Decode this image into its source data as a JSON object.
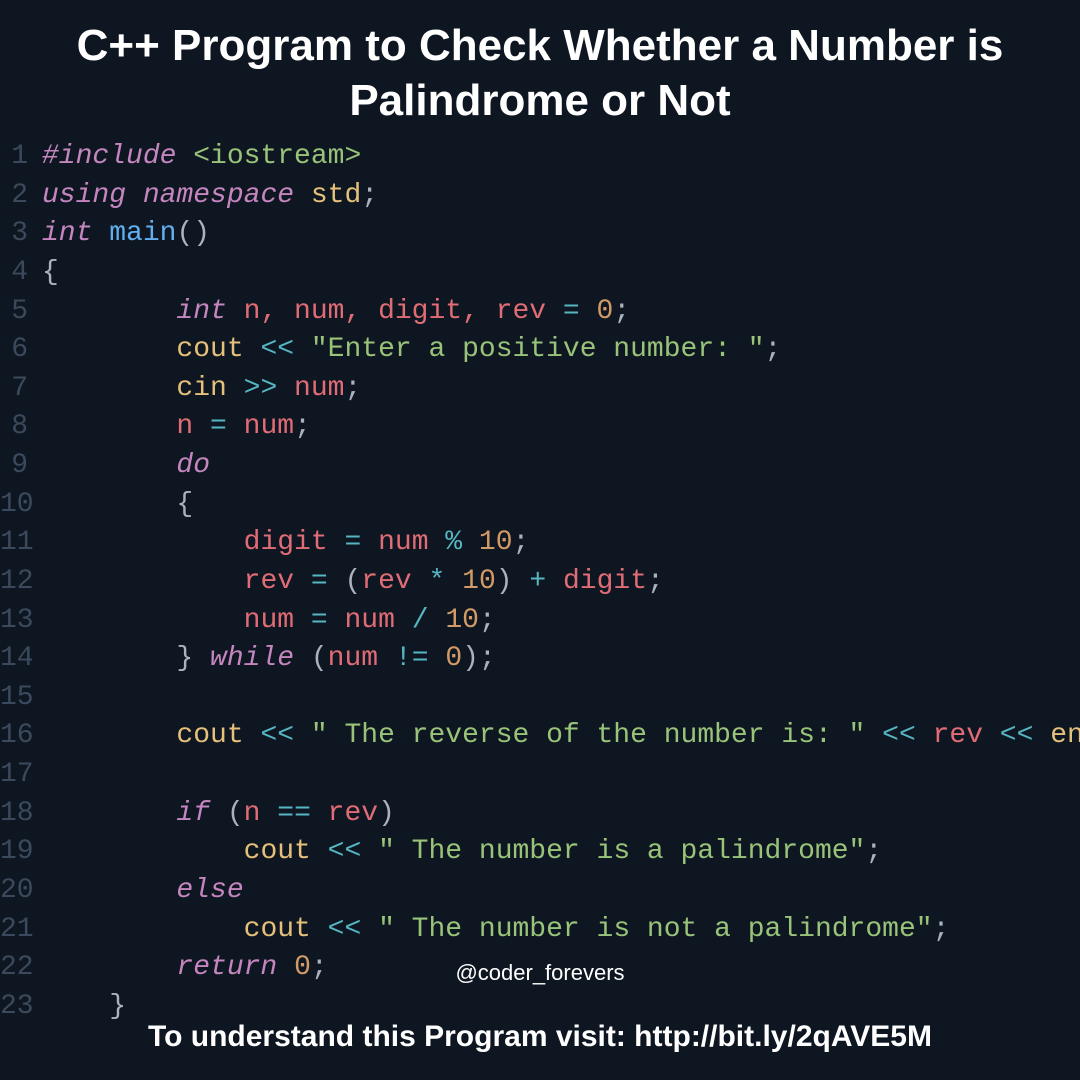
{
  "title": "C++ Program to Check Whether a Number is Palindrome or Not",
  "handle": "@coder_forevers",
  "footer": "To understand this Program visit: http://bit.ly/2qAVE5M",
  "code": {
    "ln1_include": "#include",
    "ln1_header": " <iostream>",
    "ln2_using": "using",
    "ln2_namespace": " namespace",
    "ln2_std": " std",
    "ln2_semi": ";",
    "ln3_int": "int",
    "ln3_main": " main",
    "ln3_paren": "()",
    "ln4_brace": "{",
    "ln5_indent": "        ",
    "ln5_int": "int",
    "ln5_vars": " n, num, digit, rev ",
    "ln5_eq": "=",
    "ln5_sp": " ",
    "ln5_zero": "0",
    "ln5_semi": ";",
    "ln6_indent": "        ",
    "ln6_cout": "cout ",
    "ln6_op": "<<",
    "ln6_sp": " ",
    "ln6_str": "\"Enter a positive number: \"",
    "ln6_semi": ";",
    "ln7_indent": "        ",
    "ln7_cin": "cin ",
    "ln7_op": ">>",
    "ln7_var": " num",
    "ln7_semi": ";",
    "ln8_indent": "        ",
    "ln8_n": "n ",
    "ln8_eq": "=",
    "ln8_num": " num",
    "ln8_semi": ";",
    "ln9_indent": "        ",
    "ln9_do": "do",
    "ln10_indent": "        ",
    "ln10_brace": "{",
    "ln11_indent": "            ",
    "ln11_digit": "digit ",
    "ln11_eq": "=",
    "ln11_num": " num ",
    "ln11_mod": "%",
    "ln11_sp": " ",
    "ln11_ten": "10",
    "ln11_semi": ";",
    "ln12_indent": "            ",
    "ln12_rev": "rev ",
    "ln12_eq": "=",
    "ln12_sp1": " ",
    "ln12_lp": "(",
    "ln12_rev2": "rev ",
    "ln12_mul": "*",
    "ln12_sp2": " ",
    "ln12_ten": "10",
    "ln12_rp": ")",
    "ln12_sp3": " ",
    "ln12_plus": "+",
    "ln12_digit": " digit",
    "ln12_semi": ";",
    "ln13_indent": "            ",
    "ln13_num": "num ",
    "ln13_eq": "=",
    "ln13_num2": " num ",
    "ln13_div": "/",
    "ln13_sp": " ",
    "ln13_ten": "10",
    "ln13_semi": ";",
    "ln14_indent": "        ",
    "ln14_brace": "} ",
    "ln14_while": "while",
    "ln14_sp": " ",
    "ln14_lp": "(",
    "ln14_num": "num ",
    "ln14_neq": "!=",
    "ln14_sp2": " ",
    "ln14_zero": "0",
    "ln14_rp": ")",
    "ln14_semi": ";",
    "ln16_indent": "        ",
    "ln16_cout": "cout ",
    "ln16_op1": "<<",
    "ln16_sp1": " ",
    "ln16_str": "\" The reverse of the number is: \"",
    "ln16_sp2": " ",
    "ln16_op2": "<<",
    "ln16_rev": " rev ",
    "ln16_op3": "<<",
    "ln16_endl": " endl",
    "ln16_semi": ";",
    "ln18_indent": "        ",
    "ln18_if": "if",
    "ln18_sp": " ",
    "ln18_lp": "(",
    "ln18_n": "n ",
    "ln18_eqeq": "==",
    "ln18_rev": " rev",
    "ln18_rp": ")",
    "ln19_indent": "            ",
    "ln19_cout": "cout ",
    "ln19_op": "<<",
    "ln19_sp": " ",
    "ln19_str": "\" The number is a palindrome\"",
    "ln19_semi": ";",
    "ln20_indent": "        ",
    "ln20_else": "else",
    "ln21_indent": "            ",
    "ln21_cout": "cout ",
    "ln21_op": "<<",
    "ln21_sp": " ",
    "ln21_str": "\" The number is not a palindrome\"",
    "ln21_semi": ";",
    "ln22_indent": "        ",
    "ln22_return": "return",
    "ln22_sp": " ",
    "ln22_zero": "0",
    "ln22_semi": ";",
    "ln23_indent": "    ",
    "ln23_brace": "}",
    "lineno": {
      "l1": "1",
      "l2": "2",
      "l3": "3",
      "l4": "4",
      "l5": "5",
      "l6": "6",
      "l7": "7",
      "l8": "8",
      "l9": "9",
      "l10": "10",
      "l11": "11",
      "l12": "12",
      "l13": "13",
      "l14": "14",
      "l15": "15",
      "l16": "16",
      "l17": "17",
      "l18": "18",
      "l19": "19",
      "l20": "20",
      "l21": "21",
      "l22": "22",
      "l23": "23"
    }
  }
}
